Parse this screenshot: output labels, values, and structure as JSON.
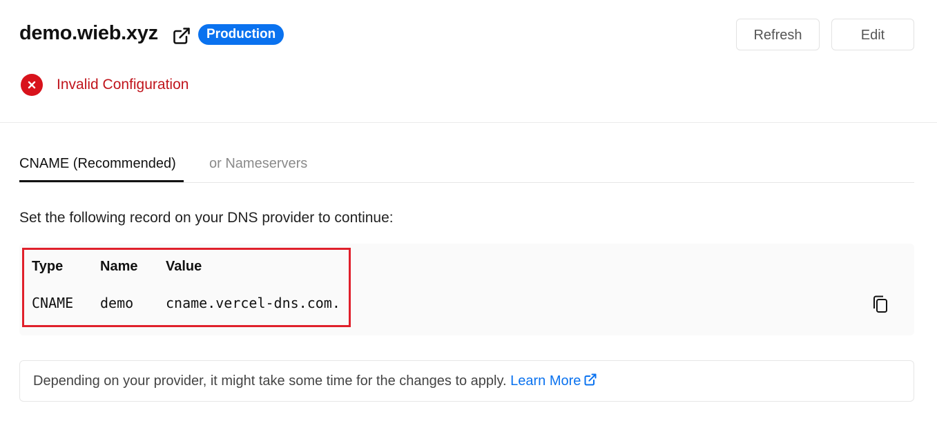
{
  "header": {
    "domain": "demo.wieb.xyz",
    "badge": "Production",
    "refresh_label": "Refresh",
    "edit_label": "Edit"
  },
  "status": {
    "text": "Invalid Configuration",
    "icon": "x-circle-icon",
    "color": "#d8131c"
  },
  "tabs": [
    {
      "label": "CNAME (Recommended)",
      "active": true
    },
    {
      "label": "or Nameservers",
      "active": false
    }
  ],
  "instructions": "Set the following record on your DNS provider to continue:",
  "record": {
    "headers": [
      "Type",
      "Name",
      "Value"
    ],
    "row": [
      "CNAME",
      "demo",
      "cname.vercel-dns.com."
    ]
  },
  "note": {
    "text": "Depending on your provider, it might take some time for the changes to apply.",
    "link_label": "Learn More"
  },
  "colors": {
    "accent": "#0a72ef",
    "error": "#c0141c",
    "highlight": "#e0202b"
  }
}
